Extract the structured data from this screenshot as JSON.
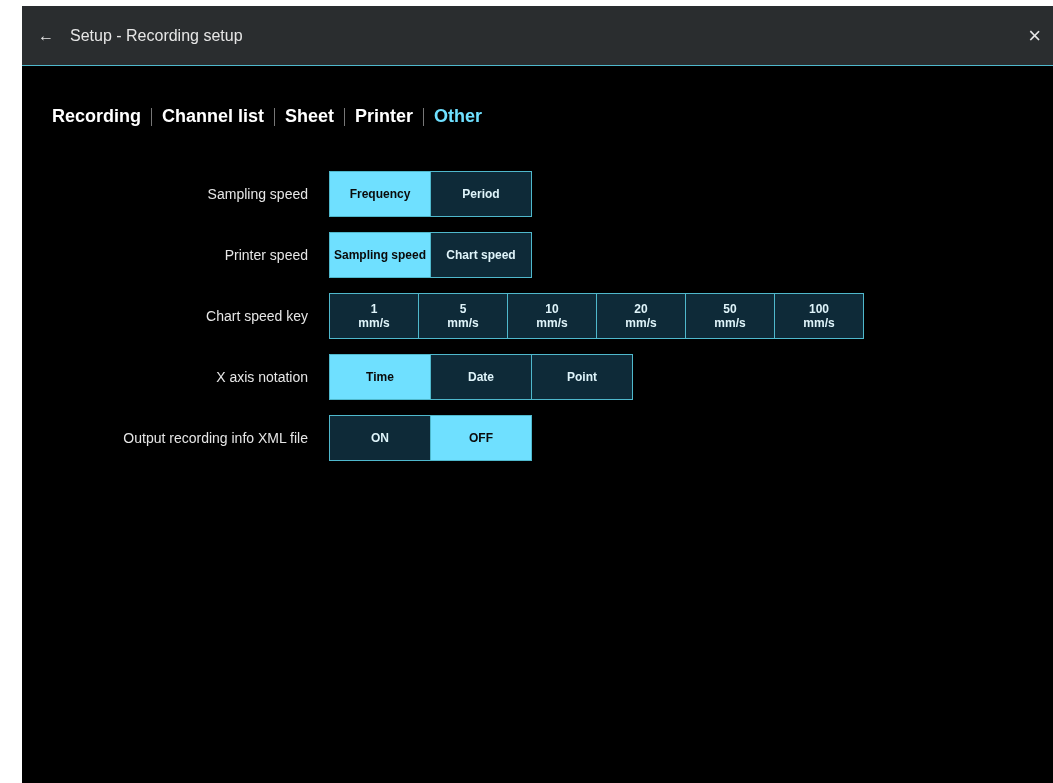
{
  "window": {
    "title": "Setup - Recording setup",
    "back": "←",
    "close": "×"
  },
  "tabs": [
    {
      "label": "Recording",
      "selected": false
    },
    {
      "label": "Channel list",
      "selected": false
    },
    {
      "label": "Sheet",
      "selected": false
    },
    {
      "label": "Printer",
      "selected": false
    },
    {
      "label": "Other",
      "selected": true
    }
  ],
  "settings": [
    {
      "label": "Sampling speed",
      "options": [
        {
          "label": "Frequency",
          "selected": true
        },
        {
          "label": "Period",
          "selected": false
        }
      ]
    },
    {
      "label": "Printer speed",
      "options": [
        {
          "label": "Sampling speed",
          "selected": true
        },
        {
          "label": "Chart speed",
          "selected": false
        }
      ]
    },
    {
      "label": "Chart speed key",
      "options": [
        {
          "label": "1\nmm/s",
          "selected": false
        },
        {
          "label": "5\nmm/s",
          "selected": false
        },
        {
          "label": "10\nmm/s",
          "selected": false
        },
        {
          "label": "20\nmm/s",
          "selected": false
        },
        {
          "label": "50\nmm/s",
          "selected": false
        },
        {
          "label": "100\nmm/s",
          "selected": false
        }
      ]
    },
    {
      "label": "X axis notation",
      "options": [
        {
          "label": "Time",
          "selected": true
        },
        {
          "label": "Date",
          "selected": false
        },
        {
          "label": "Point",
          "selected": false
        }
      ]
    },
    {
      "label": "Output recording info XML file",
      "options": [
        {
          "label": "ON",
          "selected": false
        },
        {
          "label": "OFF",
          "selected": true
        }
      ]
    }
  ]
}
